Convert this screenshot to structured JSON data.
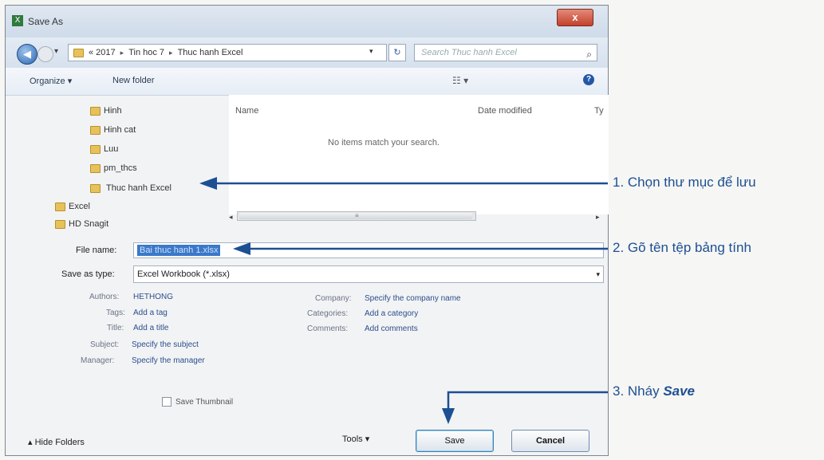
{
  "window": {
    "title": "Save As",
    "close_glyph": "x"
  },
  "address": {
    "crumbs": [
      "« 2017",
      "Tin hoc 7",
      "Thuc hanh Excel"
    ],
    "search_placeholder": "Search Thuc hanh Excel"
  },
  "toolbar": {
    "organize": "Organize ▾",
    "new_folder": "New folder"
  },
  "tree": [
    {
      "label": "Hinh"
    },
    {
      "label": "Hinh cat"
    },
    {
      "label": "Luu"
    },
    {
      "label": "pm_thcs"
    },
    {
      "label": "Thuc hanh Excel"
    },
    {
      "label": "Excel"
    },
    {
      "label": "HD Snagit"
    }
  ],
  "columns": {
    "name": "Name",
    "date_modified": "Date modified",
    "type": "Ty"
  },
  "empty_message": "No items match your search.",
  "form": {
    "file_name_label": "File name:",
    "file_name_value": "Bai thuc hanh 1.xlsx",
    "save_type_label": "Save as type:",
    "save_type_value": "Excel Workbook (*.xlsx)"
  },
  "meta": {
    "authors_label": "Authors:",
    "authors_value": "HETHONG",
    "tags_label": "Tags:",
    "tags_value": "Add a tag",
    "title_label": "Title:",
    "title_value": "Add a title",
    "subject_label": "Subject:",
    "subject_value": "Specify the subject",
    "manager_label": "Manager:",
    "manager_value": "Specify the manager",
    "company_label": "Company:",
    "company_value": "Specify the company name",
    "categories_label": "Categories:",
    "categories_value": "Add a category",
    "comments_label": "Comments:",
    "comments_value": "Add comments"
  },
  "save_thumbnail": "Save Thumbnail",
  "bottom": {
    "hide_folders": "Hide Folders",
    "tools": "Tools ▾",
    "save": "Save",
    "cancel": "Cancel"
  },
  "annotations": {
    "step1": "1. Chọn thư mục để lưu",
    "step2": "2. Gõ tên tệp bảng tính",
    "step3_prefix": "3. Nháy ",
    "step3_emph": "Save"
  },
  "colors": {
    "annotation": "#1d4f93",
    "selection": "#3a78c9"
  }
}
